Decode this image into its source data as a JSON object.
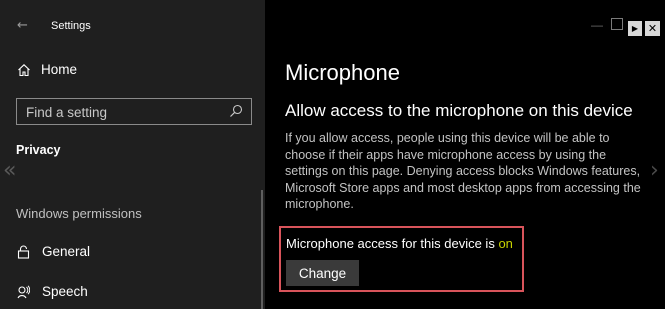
{
  "window": {
    "app_title": "Settings",
    "back_icon": "back-arrow-icon",
    "controls": [
      "minimize-icon",
      "maximize-icon",
      "play-icon",
      "close-icon"
    ]
  },
  "sidebar": {
    "home_label": "Home",
    "search_placeholder": "Find a setting",
    "section": "Privacy",
    "group_header": "Windows permissions",
    "items": [
      {
        "label": "General",
        "icon": "lock-icon"
      },
      {
        "label": "Speech",
        "icon": "speech-icon"
      }
    ]
  },
  "main": {
    "page_title": "Microphone",
    "section_title": "Allow access to the microphone on this device",
    "description": "If you allow access, people using this device will be able to choose if their apps have microphone access by using the settings on this page. Denying access blocks Windows features, Microsoft Store apps and most desktop apps from accessing the microphone.",
    "status_prefix": "Microphone access for this device is ",
    "status_value": "on",
    "change_label": "Change"
  },
  "colors": {
    "sidebar_bg": "#1f1f1f",
    "main_bg": "#000000",
    "status_on": "#c9d400",
    "highlight_border": "#d9545b"
  }
}
